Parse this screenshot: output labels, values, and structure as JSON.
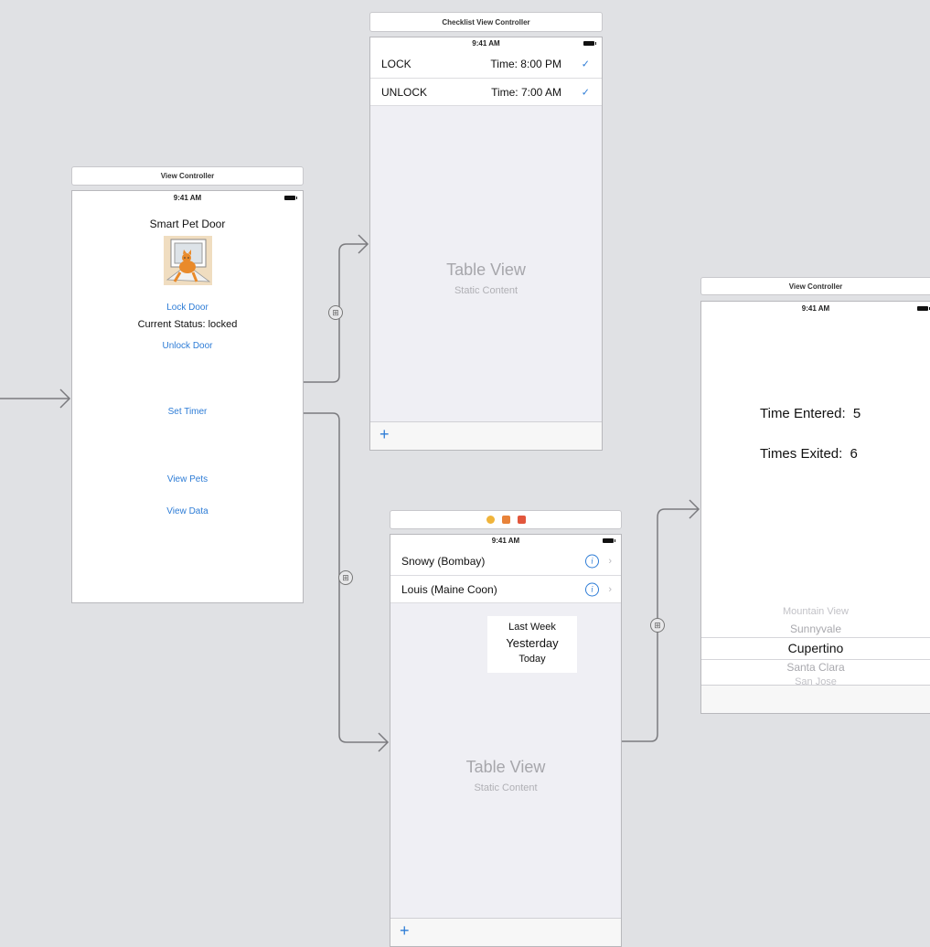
{
  "scenes": {
    "main": {
      "title": "View Controller",
      "time": "9:41 AM",
      "heading": "Smart Pet Door",
      "lock_label": "Lock Door",
      "status_label": "Current Status: locked",
      "unlock_label": "Unlock Door",
      "timer_label": "Set Timer",
      "pets_label": "View Pets",
      "data_label": "View Data"
    },
    "checklist": {
      "title": "Checklist View Controller",
      "time": "9:41 AM",
      "rows": [
        {
          "label": "LOCK",
          "detail": "Time: 8:00 PM"
        },
        {
          "label": "UNLOCK",
          "detail": "Time: 7:00 AM"
        }
      ],
      "placeholder_title": "Table View",
      "placeholder_subtitle": "Static Content",
      "add_label": "+"
    },
    "pets": {
      "time": "9:41 AM",
      "rows": [
        {
          "label": "Snowy (Bombay)"
        },
        {
          "label": "Louis (Maine Coon)"
        }
      ],
      "picker_items": [
        "Last Week",
        "Yesterday",
        "Today"
      ],
      "placeholder_title": "Table View",
      "placeholder_subtitle": "Static Content",
      "add_label": "+"
    },
    "data": {
      "title": "View Controller",
      "time": "9:41 AM",
      "entered_label": "Time Entered:",
      "entered_value": "5",
      "exited_label": "Times Exited:",
      "exited_value": "6",
      "picker_items": [
        "Mountain View",
        "Sunnyvale",
        "Cupertino",
        "Santa Clara",
        "San Jose"
      ]
    }
  },
  "colors": {
    "canvas": "#e0e1e4",
    "link": "#2d7cd6",
    "segue": "#7a7a7e"
  },
  "icons": [
    "checkmark-icon",
    "info-icon",
    "chevron-right-icon",
    "segue-icon",
    "battery-icon",
    "plus-icon",
    "first-responder-icon",
    "exit-icon"
  ]
}
